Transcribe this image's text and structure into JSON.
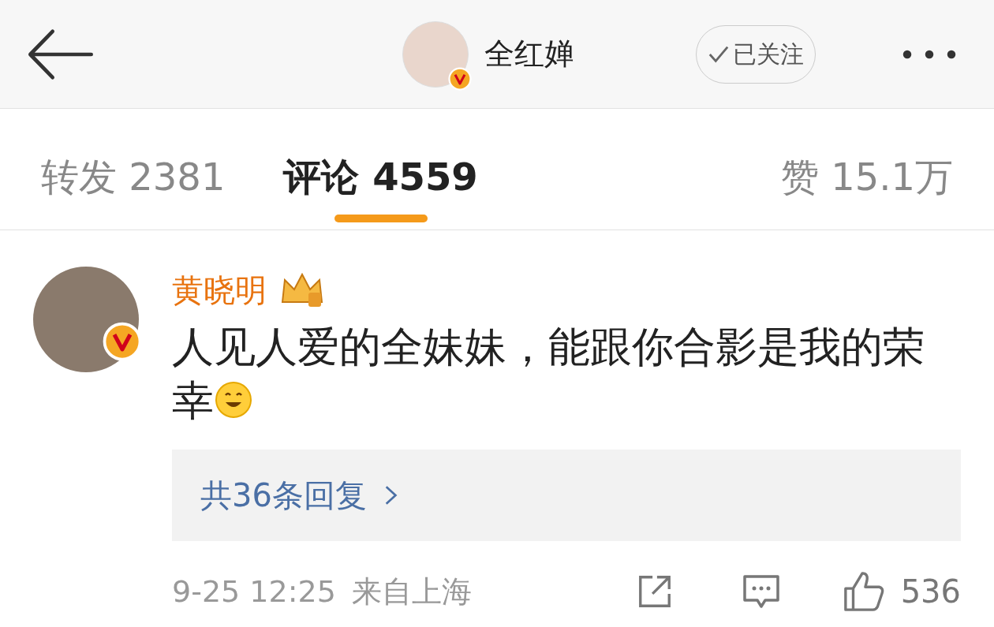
{
  "header": {
    "user_name": "全红婵",
    "follow_button": {
      "label": "已关注",
      "followed": true
    }
  },
  "tabs": [
    {
      "label": "转发",
      "count": "2381",
      "selected": false
    },
    {
      "label": "评论",
      "count": "4559",
      "selected": true
    },
    {
      "label": "赞",
      "count": "15.1万",
      "selected": false
    }
  ],
  "comment": {
    "user_name": "黄晓明",
    "text": "人见人爱的全妹妹，能跟你合影是我的荣幸",
    "replies_link": "共36条回复",
    "time": "9-25 12:25",
    "location": "来自上海",
    "like_count": "536"
  }
}
